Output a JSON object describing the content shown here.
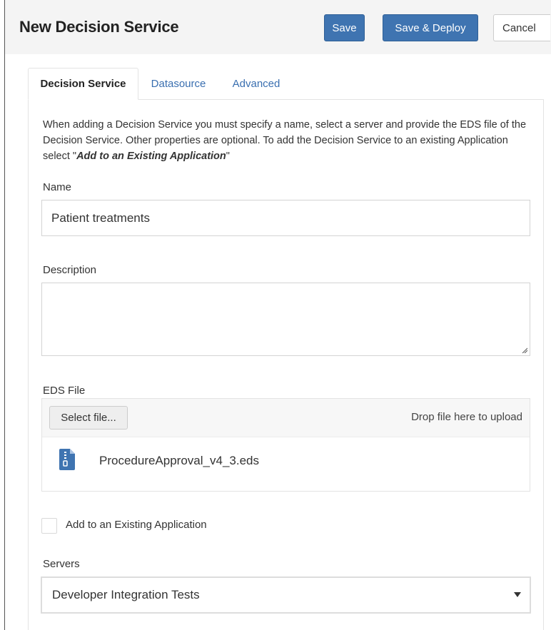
{
  "header": {
    "title": "New Decision Service",
    "save_label": "Save",
    "save_deploy_label": "Save & Deploy",
    "cancel_label": "Cancel"
  },
  "tabs": [
    {
      "label": "Decision Service",
      "active": true
    },
    {
      "label": "Datasource",
      "active": false
    },
    {
      "label": "Advanced",
      "active": false
    }
  ],
  "form": {
    "intro_text": "When adding a Decision Service you must specify a name, select a server and provide the EDS file of the Decision Service. Other properties are optional. To add the Decision Service to an existing Application select \"",
    "intro_emphasis": "Add to an Existing Application",
    "intro_suffix": "\"",
    "name_label": "Name",
    "name_value": "Patient treatments",
    "description_label": "Description",
    "description_value": "",
    "eds_label": "EDS File",
    "select_file_label": "Select file...",
    "drop_hint": "Drop file here to upload",
    "uploaded_file": "ProcedureApproval_v4_3.eds",
    "file_icon": "zip-file-icon",
    "add_existing_label": "Add to an Existing Application",
    "add_existing_checked": false,
    "servers_label": "Servers",
    "server_selected": "Developer Integration Tests"
  },
  "colors": {
    "primary": "#3f74b1",
    "link": "#3a6fb0",
    "header_bg": "#f4f4f4"
  }
}
